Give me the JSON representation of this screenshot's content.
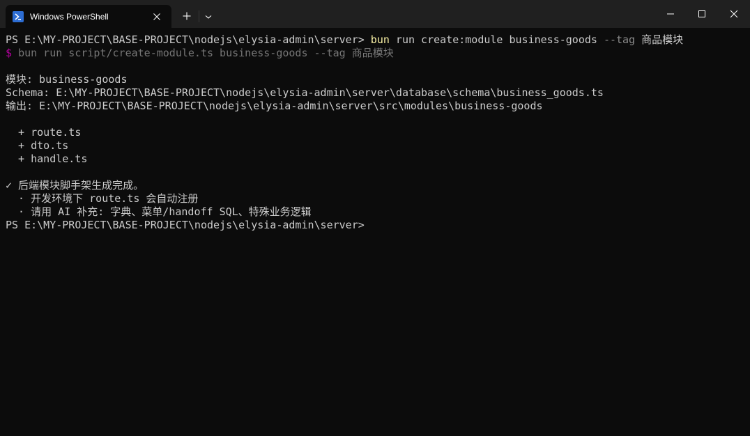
{
  "window": {
    "tab_title": "Windows PowerShell",
    "icons": {
      "tab": "powershell-icon",
      "close_tab": "close-icon",
      "new_tab": "plus-icon",
      "dropdown": "chevron-down-icon",
      "minimize": "minimize-icon",
      "maximize": "maximize-icon",
      "close": "close-icon"
    }
  },
  "colors": {
    "background": "#0c0c0c",
    "titlebar": "#202020",
    "text": "#cccccc",
    "command": "#f9f1a5",
    "param": "#8a8a8a",
    "prompt_marker": "#b4009e"
  },
  "terminal": {
    "prompt1": "PS E:\\MY-PROJECT\\BASE-PROJECT\\nodejs\\elysia-admin\\server>",
    "cmd_name": "bun",
    "cmd_args": "run create:module business-goods",
    "cmd_flag": "--tag",
    "cmd_flag_value": "商品模块",
    "echo_marker": "$",
    "echo_text": "bun run script/create-module.ts business-goods --tag 商品模块",
    "module_line": "模块: business-goods",
    "schema_line": "Schema: E:\\MY-PROJECT\\BASE-PROJECT\\nodejs\\elysia-admin\\server\\database\\schema\\business_goods.ts",
    "output_line": "输出: E:\\MY-PROJECT\\BASE-PROJECT\\nodejs\\elysia-admin\\server\\src\\modules\\business-goods",
    "files": [
      "  + route.ts",
      "  + dto.ts",
      "  + handle.ts"
    ],
    "done_line": "✓ 后端模块脚手架生成完成。",
    "notes": [
      "  · 开发环境下 route.ts 会自动注册",
      "  · 请用 AI 补充: 字典、菜单/handoff SQL、特殊业务逻辑"
    ],
    "prompt2": "PS E:\\MY-PROJECT\\BASE-PROJECT\\nodejs\\elysia-admin\\server>"
  }
}
